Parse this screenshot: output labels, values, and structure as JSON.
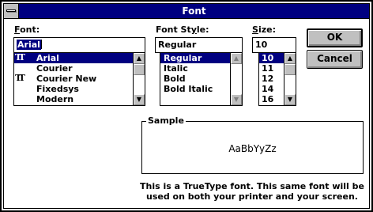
{
  "window": {
    "title": "Font"
  },
  "font": {
    "label": "Font:",
    "label_underline": "F",
    "label_rest": "ont:",
    "value": "Arial",
    "items": [
      {
        "label": "Arial",
        "truetype": true,
        "selected": true
      },
      {
        "label": "Courier",
        "truetype": false,
        "selected": false
      },
      {
        "label": "Courier New",
        "truetype": true,
        "selected": false
      },
      {
        "label": "Fixedsys",
        "truetype": false,
        "selected": false
      },
      {
        "label": "Modern",
        "truetype": false,
        "selected": false
      }
    ]
  },
  "style": {
    "label": "Font Style:",
    "label_pre": "Font St",
    "label_underline": "y",
    "label_rest": "le:",
    "value": "Regular",
    "items": [
      {
        "label": "Regular",
        "selected": true
      },
      {
        "label": "Italic",
        "selected": false
      },
      {
        "label": "Bold",
        "selected": false
      },
      {
        "label": "Bold Italic",
        "selected": false
      }
    ]
  },
  "size": {
    "label": "Size:",
    "label_underline": "S",
    "label_rest": "ize:",
    "value": "10",
    "items": [
      {
        "label": "10",
        "selected": true
      },
      {
        "label": "11",
        "selected": false
      },
      {
        "label": "12",
        "selected": false
      },
      {
        "label": "14",
        "selected": false
      },
      {
        "label": "16",
        "selected": false
      }
    ]
  },
  "buttons": {
    "ok": "OK",
    "cancel": "Cancel"
  },
  "sample": {
    "label": "Sample",
    "text": "AaBbYyZz"
  },
  "description": {
    "line1": "This is a TrueType font. This same font will be",
    "line2": "used on both your printer and your screen."
  },
  "icons": {
    "up": "▲",
    "down": "▼",
    "truetype": "TT"
  },
  "colors": {
    "titlebar": "#000080",
    "selection": "#000080",
    "face": "#c0c0c0"
  }
}
